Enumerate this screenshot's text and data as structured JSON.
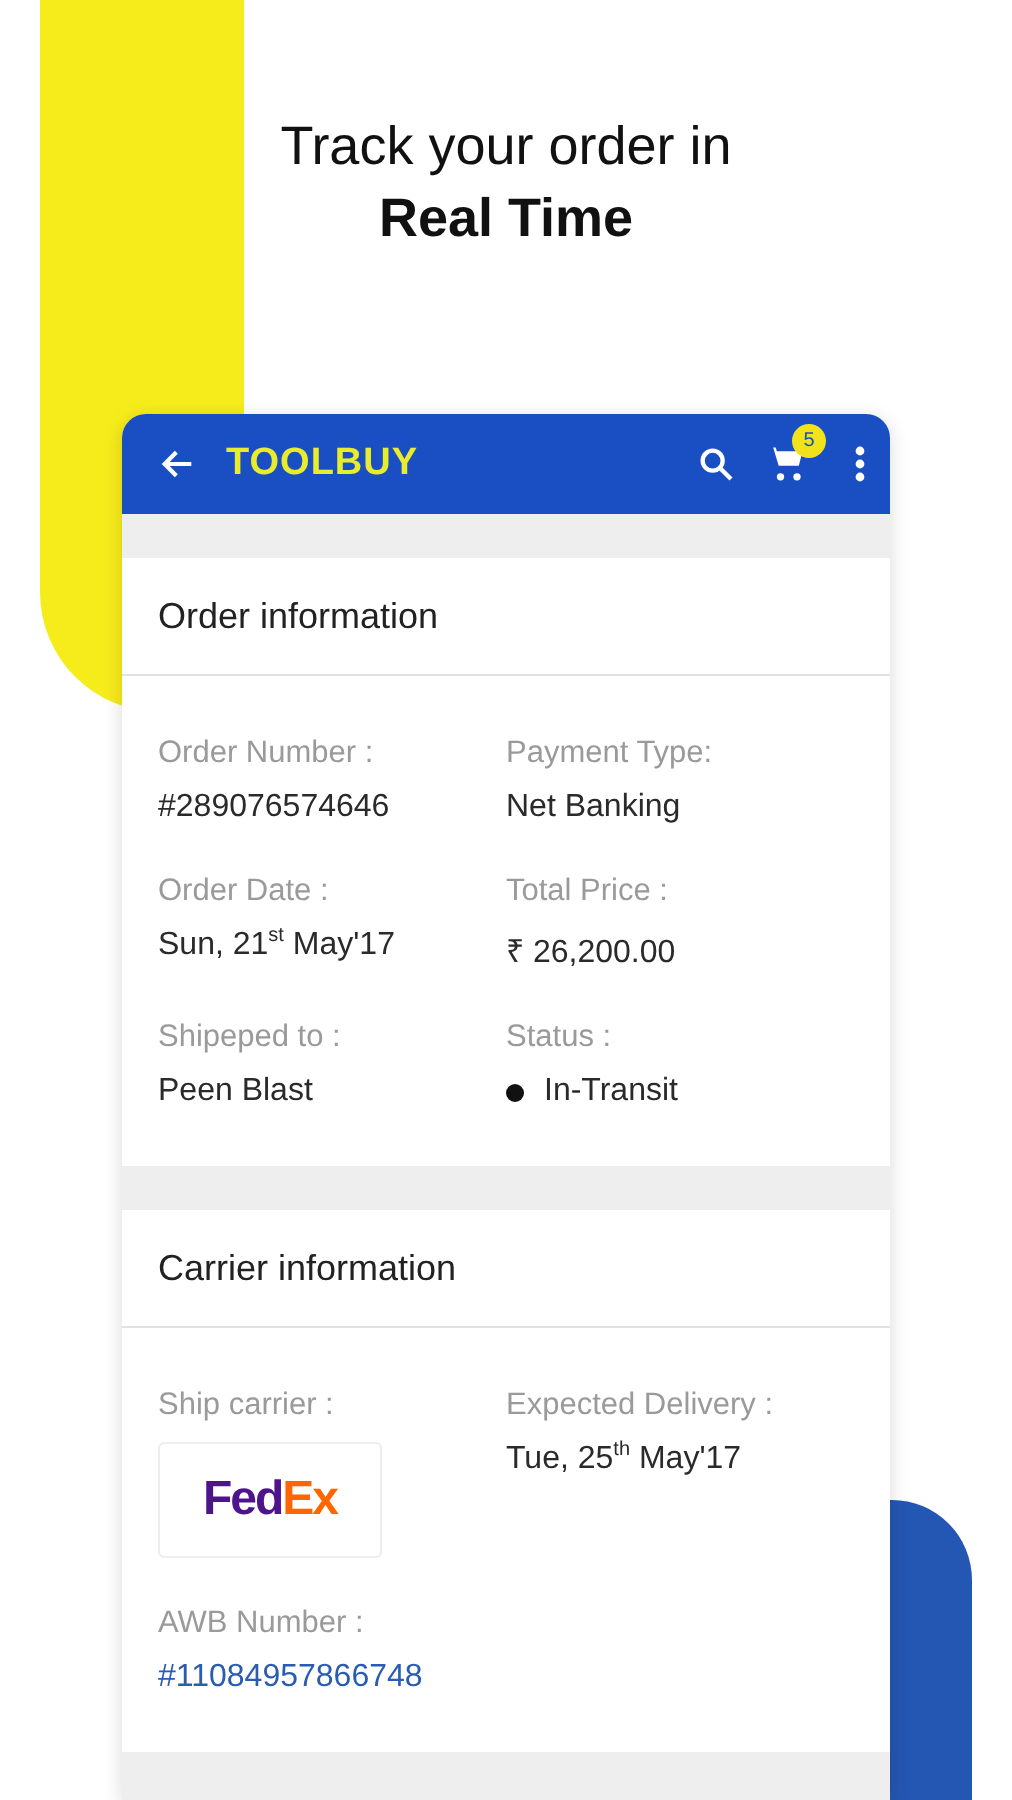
{
  "headline": {
    "line_1": "Track your order in",
    "line_2": "Real Time"
  },
  "app_bar": {
    "logo": "TOOLBUY",
    "cart_count": "5"
  },
  "order_card": {
    "title": "Order information",
    "fields": [
      {
        "kind": "text",
        "label": "Order Number :",
        "value": "#289076574646"
      },
      {
        "kind": "text",
        "label": "Payment Type:",
        "value": "Net Banking"
      },
      {
        "kind": "text",
        "label": "Order Date :",
        "value": "Sun, 21$^{st}$ May'17"
      },
      {
        "kind": "text",
        "label": "Total Price :",
        "value": "₹ 26,200.00"
      },
      {
        "kind": "text",
        "label": "Shipeped to :",
        "value": "Peen Blast"
      },
      {
        "kind": "status",
        "label": "Status :",
        "value": "In-Transit"
      }
    ]
  },
  "carrier_card": {
    "title": "Carrier information",
    "fields": [
      {
        "kind": "logo",
        "label": "Ship carrier :",
        "value": [
          "Fed",
          "Ex"
        ]
      },
      {
        "kind": "text",
        "label": "Expected Delivery :",
        "value": "Tue, 25$^{th}$ May'17"
      },
      {
        "kind": "link",
        "label": "AWB Number :",
        "value": "#11084957866748"
      }
    ]
  }
}
